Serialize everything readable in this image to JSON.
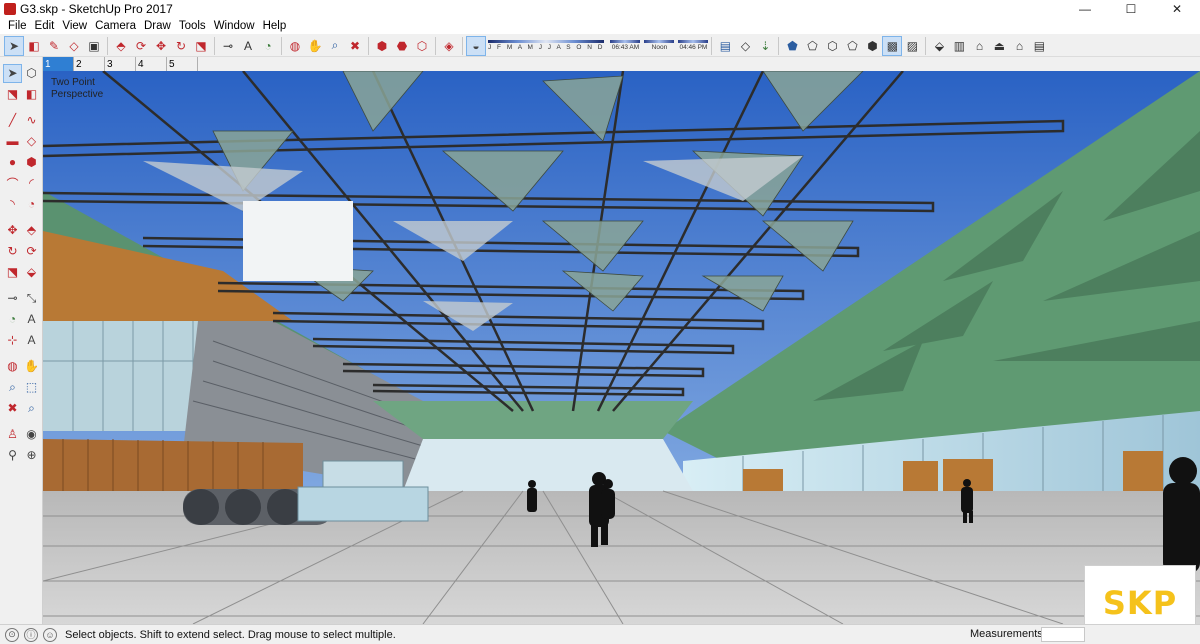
{
  "window": {
    "title": "G3.skp - SketchUp Pro 2017",
    "minimize": "—",
    "maximize": "☐",
    "close": "✕"
  },
  "menu": [
    "File",
    "Edit",
    "View",
    "Camera",
    "Draw",
    "Tools",
    "Window",
    "Help"
  ],
  "shadow_settings": {
    "months": "J F M A M J J A S O N D",
    "time_start": "06:43 AM",
    "time_mid": "Noon",
    "time_end": "04:46 PM"
  },
  "scenes": [
    "1",
    "2",
    "3",
    "4",
    "5"
  ],
  "active_scene": "1",
  "viewport": {
    "camera_line1": "Two Point",
    "camera_line2": "Perspective"
  },
  "watermark": "SKP",
  "status": {
    "hint": "Select objects. Shift to extend select. Drag mouse to select multiple.",
    "measurements_label": "Measurements",
    "measurements_value": ""
  },
  "colors": {
    "sky": "#2f6bc9",
    "wall_green": "#5f9a72",
    "floor": "#c9c9c9",
    "accent_blue": "#2f7fd3",
    "watermark": "#f5c21b"
  }
}
